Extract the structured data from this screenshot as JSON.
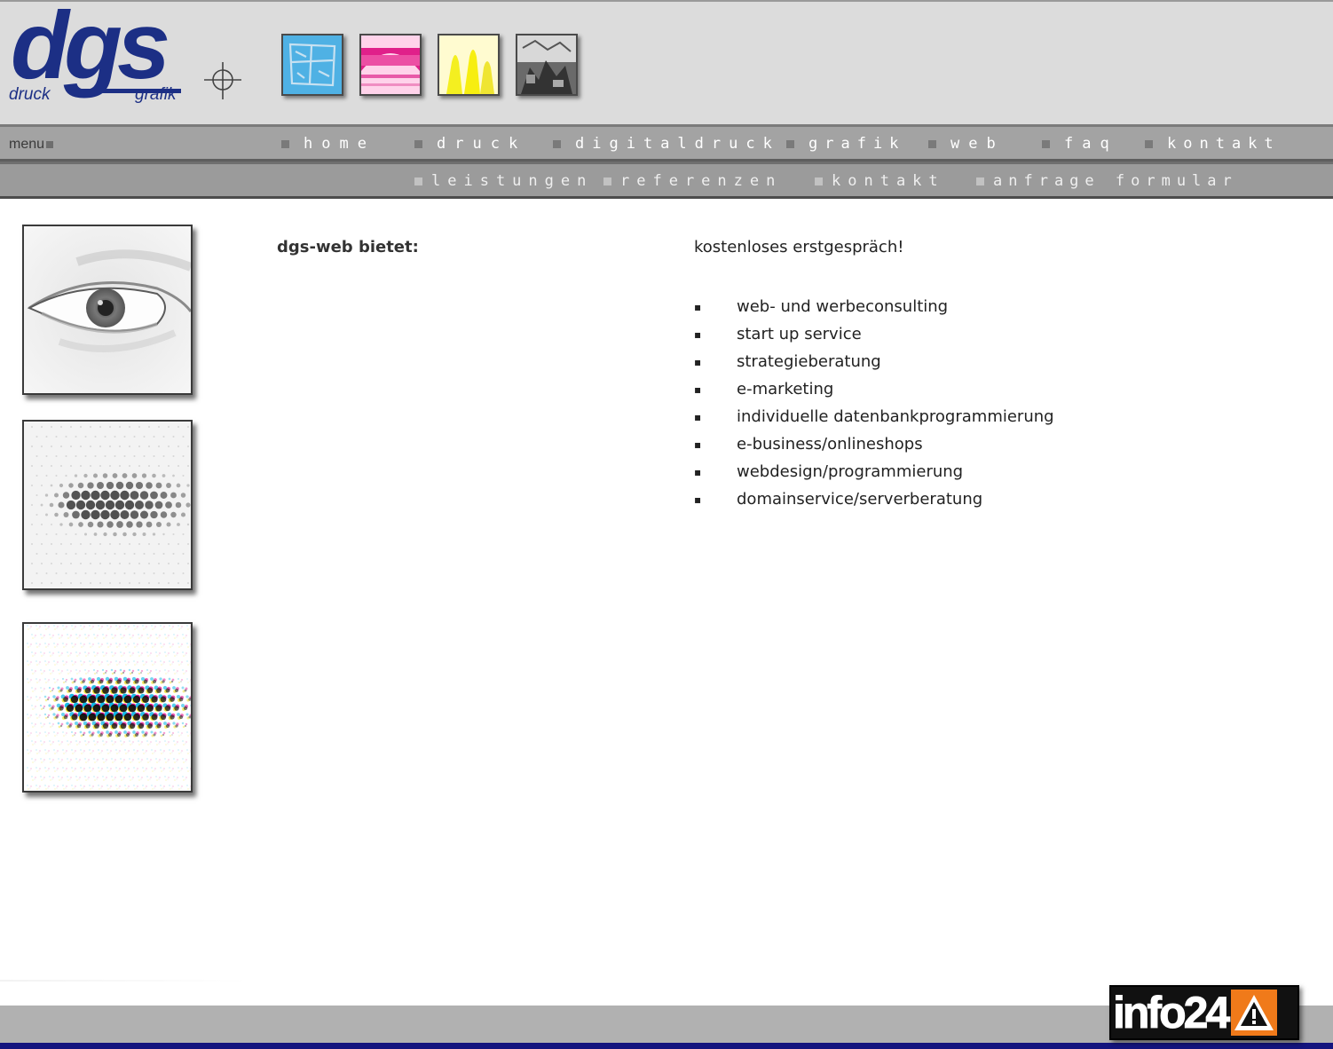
{
  "logo": {
    "main": "dgs",
    "left": "druck",
    "right": "grafik"
  },
  "header_thumbs": [
    {
      "name": "cyan-thumb",
      "color": "#3aa8e0"
    },
    {
      "name": "magenta-thumb",
      "color": "#e0208a"
    },
    {
      "name": "yellow-thumb",
      "color": "#f4ef20"
    },
    {
      "name": "black-thumb",
      "color": "#3a3a3a"
    }
  ],
  "nav": {
    "menu_label": "menu",
    "items": [
      "home",
      "druck",
      "digitaldruck",
      "grafik",
      "web",
      "faq",
      "kontakt"
    ]
  },
  "subnav": {
    "items": [
      "leistungen",
      "referenzen",
      "kontakt",
      "anfrage formular"
    ]
  },
  "content": {
    "heading": "dgs-web bietet:",
    "intro": "kostenloses erstgespräch!",
    "bullet": "▪",
    "services": [
      "web- und werbeconsulting",
      "start up service",
      "strategieberatung",
      "e-marketing",
      "individuelle datenbankprogrammierung",
      "e-business/onlineshops",
      "webdesign/programmierung",
      "domainservice/serverberatung"
    ]
  },
  "footer": {
    "badge_text": "info24",
    "strip_color": "#14147e"
  },
  "colors": {
    "logo_blue": "#1c2f85",
    "header_bg": "#dcdcdc",
    "nav_bg": "#a3a3a3"
  }
}
